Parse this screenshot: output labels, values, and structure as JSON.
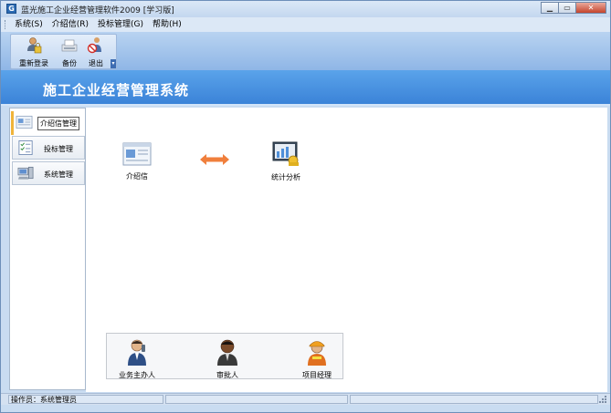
{
  "window": {
    "title": "蓝光施工企业经营管理软件2009 [学习版]",
    "app_icon": "G",
    "min_label": "▁",
    "max_label": "▭",
    "close_label": "✕"
  },
  "menu": {
    "items": [
      {
        "label": "系统(S)"
      },
      {
        "label": "介绍信(R)"
      },
      {
        "label": "投标管理(G)"
      },
      {
        "label": "帮助(H)"
      }
    ]
  },
  "toolbar": {
    "relogin_label": "重新登录",
    "backup_label": "备份",
    "exit_label": "退出"
  },
  "banner": {
    "title": "施工企业经营管理系统"
  },
  "sidebar": {
    "items": [
      {
        "label": "介绍信管理",
        "icon": "letter-icon"
      },
      {
        "label": "投标管理",
        "icon": "checklist-icon"
      },
      {
        "label": "系统管理",
        "icon": "computer-icon"
      }
    ]
  },
  "main": {
    "flow": {
      "letter_label": "介绍信",
      "stats_label": "统计分析"
    },
    "people": [
      {
        "label": "业务主办人",
        "icon": "agent-icon"
      },
      {
        "label": "审批人",
        "icon": "approver-icon"
      },
      {
        "label": "项目经理",
        "icon": "manager-icon"
      }
    ]
  },
  "statusbar": {
    "operator": "操作员：系统管理员"
  },
  "colors": {
    "banner": "#4a94e2",
    "toolbar": "#a7c6ec",
    "arrow": "#f07f3c"
  }
}
